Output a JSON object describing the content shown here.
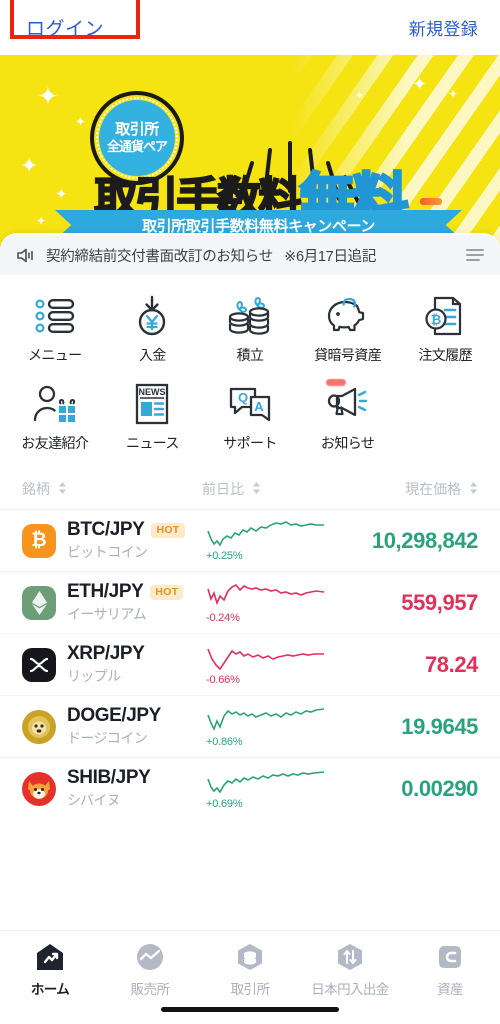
{
  "header": {
    "login_label": "ログイン",
    "signup_label": "新規登録",
    "annotation_color": "#ee2211"
  },
  "banner": {
    "badge_line1": "取引所",
    "badge_line2": "全通貨ペア",
    "headline_black": "取引手数料",
    "headline_blue": "無料",
    "ribbon_text": "取引所取引手数料無料キャンペーン",
    "bg_color": "#f5e312",
    "accent_color": "#2ea9de"
  },
  "notice": {
    "icon": "speaker-icon",
    "text": "契約締結前交付書面改訂のお知らせ",
    "suffix": "※6月17日追記",
    "menu_icon": "list-icon"
  },
  "shortcuts": [
    {
      "icon": "menu-list-icon",
      "label": "メニュー",
      "badge": false
    },
    {
      "icon": "deposit-yen-icon",
      "label": "入金",
      "badge": false
    },
    {
      "icon": "savings-coins-icon",
      "label": "積立",
      "badge": false
    },
    {
      "icon": "piggy-bank-icon",
      "label": "貸暗号資産",
      "badge": false
    },
    {
      "icon": "order-history-icon",
      "label": "注文履歴",
      "badge": false
    },
    {
      "icon": "refer-friend-icon",
      "label": "お友達紹介",
      "badge": false
    },
    {
      "icon": "news-icon",
      "label": "ニュース",
      "badge": false
    },
    {
      "icon": "support-qa-icon",
      "label": "サポート",
      "badge": false
    },
    {
      "icon": "megaphone-icon",
      "label": "お知らせ",
      "badge": true
    }
  ],
  "market": {
    "columns": {
      "symbol": "銘柄",
      "change": "前日比",
      "price": "現在価格"
    },
    "rows": [
      {
        "pair": "BTC/JPY",
        "jp": "ビットコイン",
        "hot": "HOT",
        "change": "+0.25%",
        "price": "10,298,842",
        "dir": "up",
        "icon": "bitcoin-icon"
      },
      {
        "pair": "ETH/JPY",
        "jp": "イーサリアム",
        "hot": "HOT",
        "change": "-0.24%",
        "price": "559,957",
        "dir": "down",
        "icon": "ethereum-icon"
      },
      {
        "pair": "XRP/JPY",
        "jp": "リップル",
        "hot": "",
        "change": "-0.66%",
        "price": "78.24",
        "dir": "down",
        "icon": "ripple-icon"
      },
      {
        "pair": "DOGE/JPY",
        "jp": "ドージコイン",
        "hot": "",
        "change": "+0.86%",
        "price": "19.9645",
        "dir": "up",
        "icon": "dogecoin-icon"
      },
      {
        "pair": "SHIB/JPY",
        "jp": "シバイヌ",
        "hot": "",
        "change": "+0.69%",
        "price": "0.00290",
        "dir": "up",
        "icon": "shibainu-icon"
      }
    ],
    "up_color": "#2aa37c",
    "down_color": "#e0315b"
  },
  "tabbar": [
    {
      "icon": "home-icon",
      "label": "ホーム",
      "active": true
    },
    {
      "icon": "sales-office-icon",
      "label": "販売所",
      "active": false
    },
    {
      "icon": "exchange-icon",
      "label": "取引所",
      "active": false
    },
    {
      "icon": "jpy-transfer-icon",
      "label": "日本円入出金",
      "active": false
    },
    {
      "icon": "assets-icon",
      "label": "資産",
      "active": false
    }
  ]
}
